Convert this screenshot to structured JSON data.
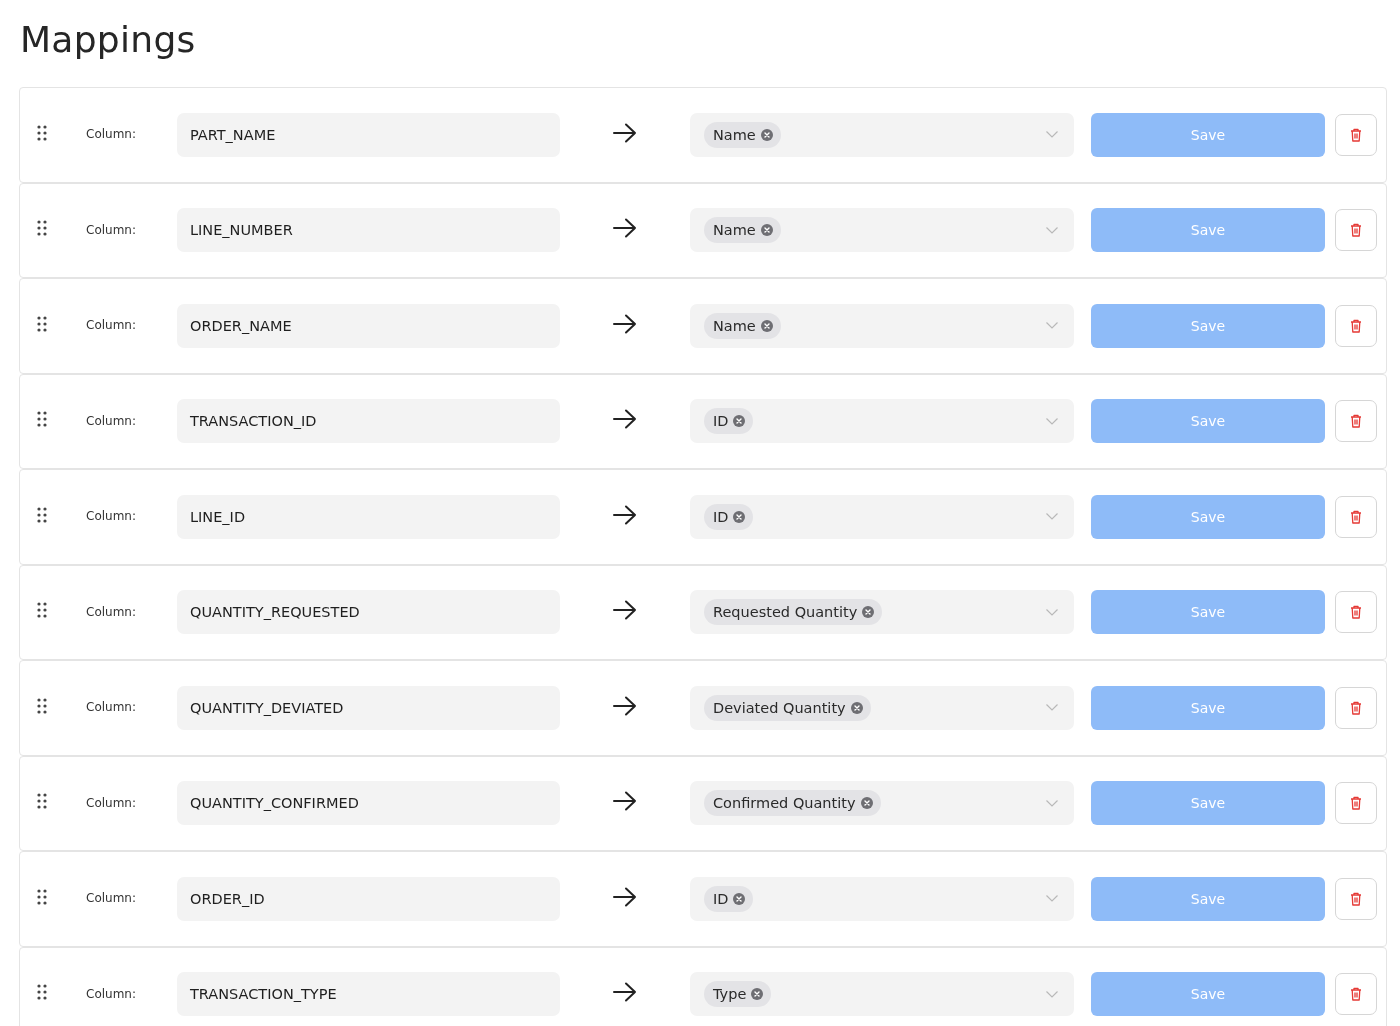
{
  "title": "Mappings",
  "mappings": [
    {
      "label": "Column:",
      "column": "PART_NAME",
      "fields": [
        {
          "label": "Name"
        }
      ],
      "save": {
        "label": "Save",
        "disabled": true
      }
    },
    {
      "label": "Column:",
      "column": "LINE_NUMBER",
      "fields": [
        {
          "label": "Name"
        }
      ],
      "save": {
        "label": "Save",
        "disabled": true
      }
    },
    {
      "label": "Column:",
      "column": "ORDER_NAME",
      "fields": [
        {
          "label": "Name"
        }
      ],
      "save": {
        "label": "Save",
        "disabled": true
      }
    },
    {
      "label": "Column:",
      "column": "TRANSACTION_ID",
      "fields": [
        {
          "label": "ID"
        }
      ],
      "save": {
        "label": "Save",
        "disabled": true
      }
    },
    {
      "label": "Column:",
      "column": "LINE_ID",
      "fields": [
        {
          "label": "ID"
        }
      ],
      "save": {
        "label": "Save",
        "disabled": true
      }
    },
    {
      "label": "Column:",
      "column": "QUANTITY_REQUESTED",
      "fields": [
        {
          "label": "Requested Quantity"
        }
      ],
      "save": {
        "label": "Save",
        "disabled": true
      }
    },
    {
      "label": "Column:",
      "column": "QUANTITY_DEVIATED",
      "fields": [
        {
          "label": "Deviated Quantity"
        }
      ],
      "save": {
        "label": "Save",
        "disabled": true
      }
    },
    {
      "label": "Column:",
      "column": "QUANTITY_CONFIRMED",
      "fields": [
        {
          "label": "Confirmed Quantity"
        }
      ],
      "save": {
        "label": "Save",
        "disabled": true
      }
    },
    {
      "label": "Column:",
      "column": "ORDER_ID",
      "fields": [
        {
          "label": "ID"
        }
      ],
      "save": {
        "label": "Save",
        "disabled": true
      }
    },
    {
      "label": "Column:",
      "column": "TRANSACTION_TYPE",
      "fields": [
        {
          "label": "Type"
        }
      ],
      "save": {
        "label": "Save",
        "disabled": true
      }
    }
  ]
}
